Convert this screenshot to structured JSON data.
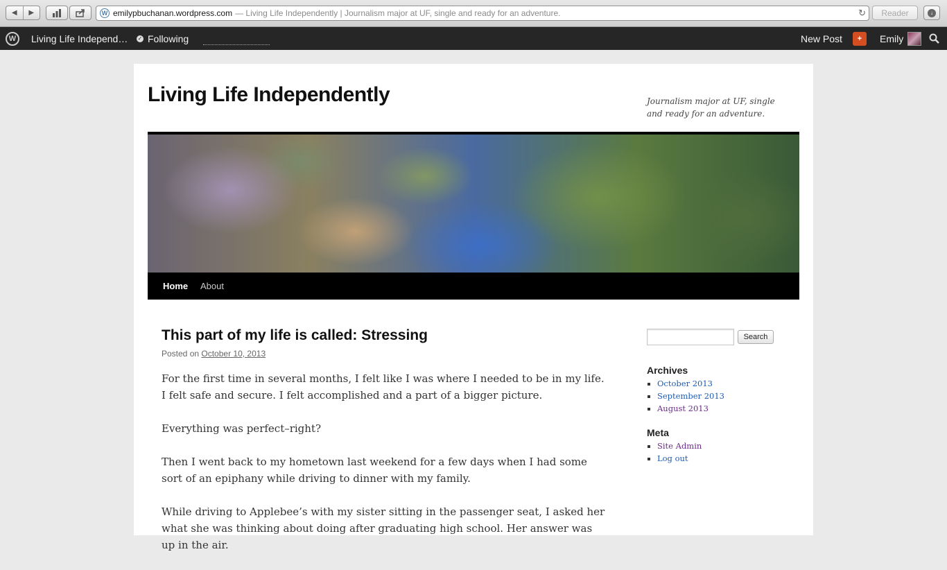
{
  "browser": {
    "url": "emilypbuchanan.wordpress.com",
    "page_title": "— Living Life Independently | Journalism major at UF, single and ready for an adventure.",
    "reader_label": "Reader"
  },
  "adminbar": {
    "site_name": "Living Life Independ…",
    "following_label": "Following",
    "new_post_label": "New Post",
    "notifications_badge": "+",
    "user_name": "Emily"
  },
  "site": {
    "title": "Living Life Independently",
    "description": "Journalism major at UF, single and ready for an adventure."
  },
  "menu": {
    "items": [
      {
        "label": "Home",
        "active": true
      },
      {
        "label": "About",
        "active": false
      }
    ]
  },
  "post": {
    "title": "This part of my life is called: Stressing",
    "posted_on_label": "Posted on",
    "date": "October 10, 2013",
    "paragraphs": [
      "For the first time in several months, I felt like I was where I needed to be in my life. I felt safe and secure. I felt accomplished and a part of a bigger picture.",
      "Everything was perfect–right?",
      "Then I went back to my hometown last weekend for a few days when I had some sort of an epiphany while driving to dinner with my family.",
      "While driving to Applebee’s with my sister sitting in the passenger seat, I asked her what she was thinking about doing after graduating high school. Her answer was up in the air."
    ]
  },
  "sidebar": {
    "search_button_label": "Search",
    "archives": {
      "title": "Archives",
      "items": [
        "October 2013",
        "September 2013",
        "August 2013"
      ]
    },
    "meta": {
      "title": "Meta",
      "items": [
        "Site Admin",
        "Log out"
      ]
    }
  },
  "colors": {
    "link": "#1b5bb5",
    "visited_link": "#6b2a8a",
    "admin_bar": "#262626",
    "notification": "#d54e21"
  }
}
